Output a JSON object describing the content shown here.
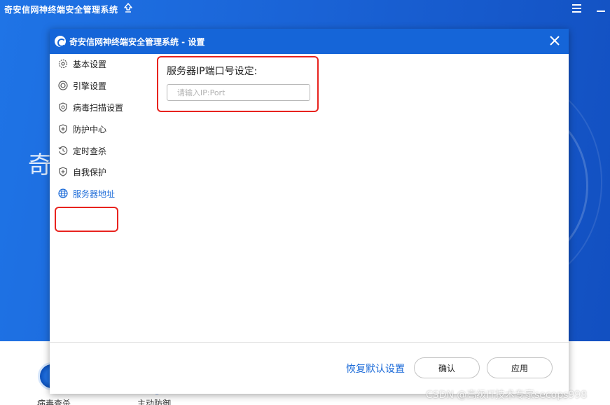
{
  "background_app": {
    "title": "奇安信网神终端安全管理系统",
    "big_text": "奇",
    "bottom_labels": [
      "病毒查杀",
      "主动防御"
    ],
    "colors": {
      "accent": "#1a63d6"
    }
  },
  "dialog": {
    "title": "奇安信网神终端安全管理系统 - 设置",
    "close_icon": "close-icon",
    "titlebar_color": "#1565d8"
  },
  "sidebar": {
    "items": [
      {
        "label": "基本设置",
        "icon": "gear-icon",
        "active": false
      },
      {
        "label": "引擎设置",
        "icon": "engine-icon",
        "active": false
      },
      {
        "label": "病毒扫描设置",
        "icon": "shield-scan-icon",
        "active": false
      },
      {
        "label": "防护中心",
        "icon": "shield-plus-icon",
        "active": false
      },
      {
        "label": "定时查杀",
        "icon": "clock-icon",
        "active": false
      },
      {
        "label": "自我保护",
        "icon": "shield-plus-icon",
        "active": false
      },
      {
        "label": "服务器地址",
        "icon": "globe-icon",
        "active": true
      }
    ],
    "active_color": "#1a6ad8"
  },
  "main": {
    "server_label": "服务器IP端口号设定:",
    "server_input": {
      "value": "",
      "placeholder": "请输入IP:Port"
    }
  },
  "footer": {
    "restore_label": "恢复默认设置",
    "confirm_label": "确认",
    "apply_label": "应用"
  },
  "watermark": "CSDN @高级IT技术专家secops998",
  "highlight_color": "#e8231e"
}
